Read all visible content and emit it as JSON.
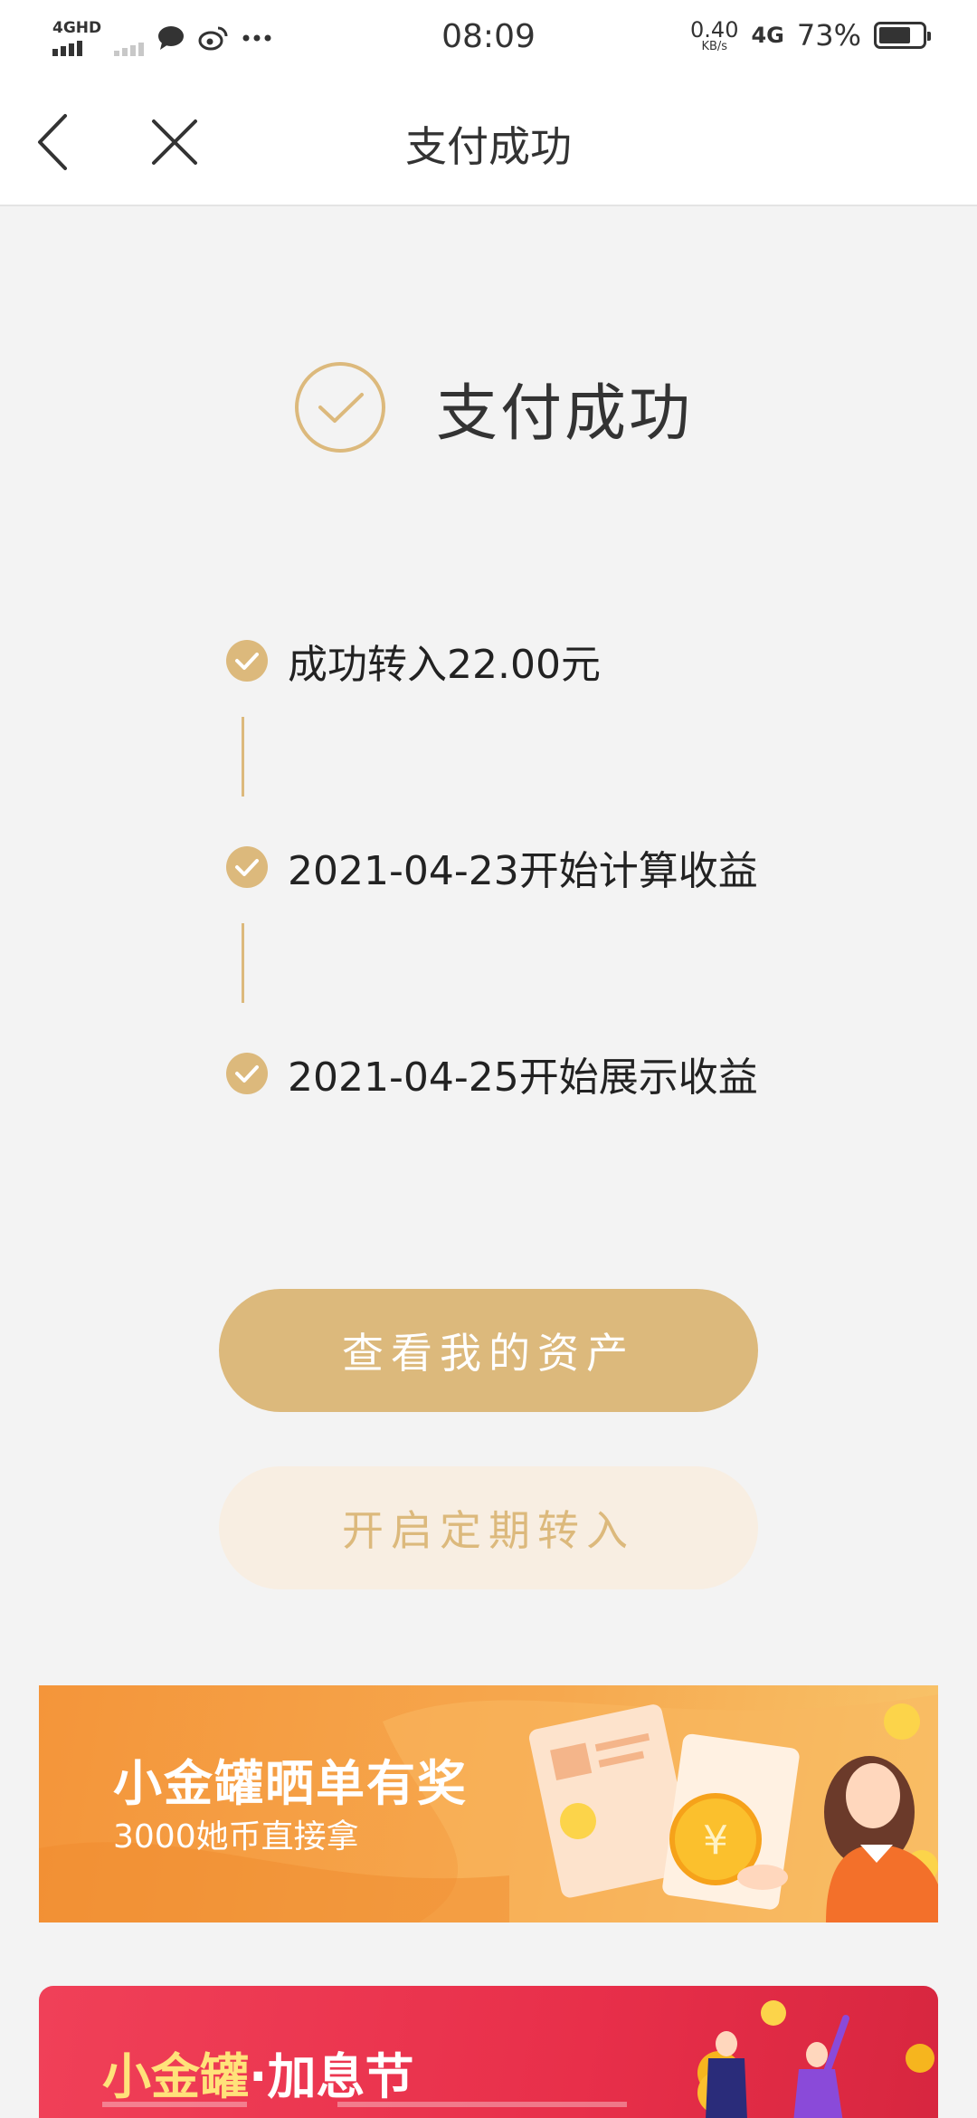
{
  "status_bar": {
    "signal_label": "4GHD",
    "time": "08:09",
    "net_speed_value": "0.40",
    "net_speed_unit": "KB/s",
    "net_type": "4G",
    "battery_percent": "73%",
    "battery_level": 0.73
  },
  "nav": {
    "title": "支付成功"
  },
  "success": {
    "title": "支付成功"
  },
  "steps": [
    {
      "text": "成功转入22.00元"
    },
    {
      "text": "2021-04-23开始计算收益"
    },
    {
      "text": "2021-04-25开始展示收益"
    }
  ],
  "buttons": {
    "primary": "查看我的资产",
    "secondary": "开启定期转入"
  },
  "banners": [
    {
      "title": "小金罐晒单有奖",
      "subtitle": "3000她币直接拿",
      "coin_symbol": "¥"
    },
    {
      "title_part1": "小金罐",
      "title_part2": "·加息节"
    }
  ],
  "colors": {
    "accent_gold": "#dcb97c",
    "secondary_button_bg": "#f8eee2",
    "page_bg": "#f3f3f3",
    "banner_orange": "#f4953a",
    "banner_red": "#e82f4a"
  }
}
